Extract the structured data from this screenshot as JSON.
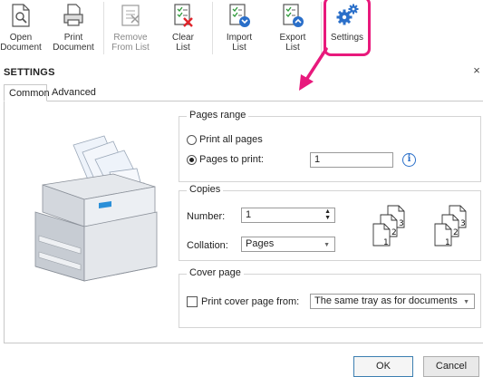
{
  "toolbar": {
    "buttons": [
      {
        "label": "Open\nDocument",
        "icon": "open-document-icon",
        "enabled": true
      },
      {
        "label": "Print\nDocument",
        "icon": "printer-icon",
        "enabled": true
      },
      {
        "label": "Remove\nFrom List",
        "icon": "remove-from-list-icon",
        "enabled": false
      },
      {
        "label": "Clear\nList",
        "icon": "clear-list-icon",
        "enabled": true
      },
      {
        "label": "Import\nList",
        "icon": "import-list-icon",
        "enabled": true
      },
      {
        "label": "Export\nList",
        "icon": "export-list-icon",
        "enabled": true
      },
      {
        "label": "Settings",
        "icon": "gears-icon",
        "enabled": true
      }
    ],
    "highlight_color": "#e8197c"
  },
  "dialog": {
    "title": "SETTINGS",
    "close_glyph": "×",
    "tabs": [
      {
        "label": "Common",
        "active": true
      },
      {
        "label": "Advanced",
        "active": false
      }
    ],
    "pages_range": {
      "title": "Pages range",
      "print_all_label": "Print all pages",
      "pages_to_print_label": "Pages to print:",
      "selected": "pages_to_print",
      "pages_value": "1",
      "info_glyph": "i"
    },
    "copies": {
      "title": "Copies",
      "number_label": "Number:",
      "number_value": "1",
      "collation_label": "Collation:",
      "collation_value": "Pages"
    },
    "cover_page": {
      "title": "Cover page",
      "checkbox_label": "Print cover page from:",
      "checked": false,
      "tray_value": "The same tray as for documents"
    },
    "ok_label": "OK",
    "cancel_label": "Cancel"
  },
  "colors": {
    "accent_blue": "#2a6fc9",
    "highlight_pink": "#e8197c"
  }
}
